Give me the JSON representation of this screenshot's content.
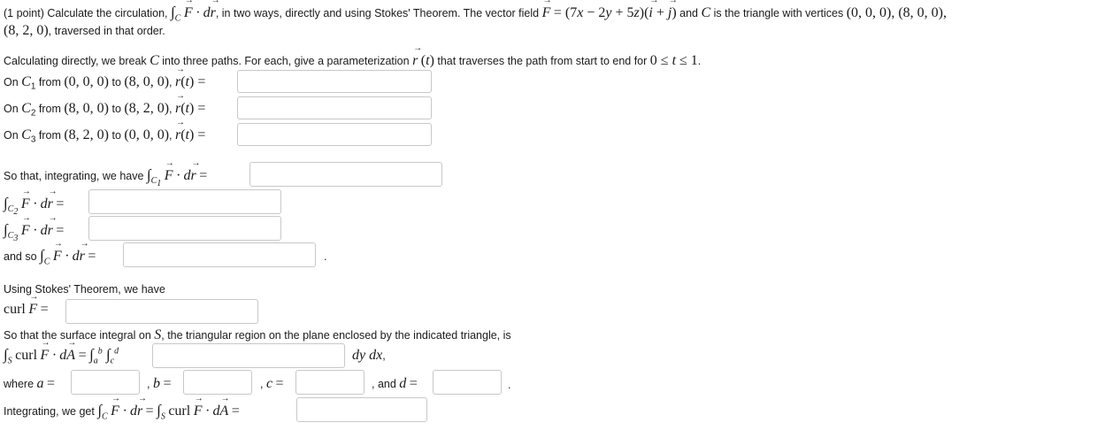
{
  "problem": {
    "intro_line1": "(1 point) Calculate the circulation, ∫C F · dr, in two ways, directly and using Stokes' Theorem. The vector field F = (7x − 2y + 5z)(i + j) and C is the triangle with vertices (0, 0, 0), (8, 0, 0),",
    "intro_line2": "(8, 2, 0), traversed in that order."
  },
  "direct": {
    "instructions": "Calculating directly, we break C into three paths. For each, give a parameterization r (t) that traverses the path from start to end for 0 ≤ t ≤ 1.",
    "paths": [
      {
        "label": "On C1 from (0, 0, 0) to (8, 0, 0), r(t) =",
        "value": ""
      },
      {
        "label": "On C2 from (8, 0, 0) to (8, 2, 0), r(t) =",
        "value": ""
      },
      {
        "label": "On C3 from (8, 2, 0) to (0, 0, 0), r(t) =",
        "value": ""
      }
    ],
    "integrals": [
      {
        "label": "So that, integrating, we have ∫C1 F · dr =",
        "value": ""
      },
      {
        "label": "∫C2 F · dr =",
        "value": ""
      },
      {
        "label": "∫C3 F · dr =",
        "value": ""
      },
      {
        "label": "and so ∫C F · dr =",
        "value": ""
      }
    ]
  },
  "stokes": {
    "heading": "Using Stokes' Theorem, we have",
    "curl_label": "curl F =",
    "surface_text": "So that the surface integral on S, the triangular region on the plane enclosed by the indicated triangle, is",
    "surface_label": "∫S curl F · dA = ∫a^b ∫c^d",
    "surface_suffix": "dy dx,",
    "where_label": "where a =",
    "b_label": ", b =",
    "c_label": ", c =",
    "d_label": ", and d =",
    "final_label": "Integrating, we get ∫C F · dr = ∫S curl F · dA ="
  }
}
